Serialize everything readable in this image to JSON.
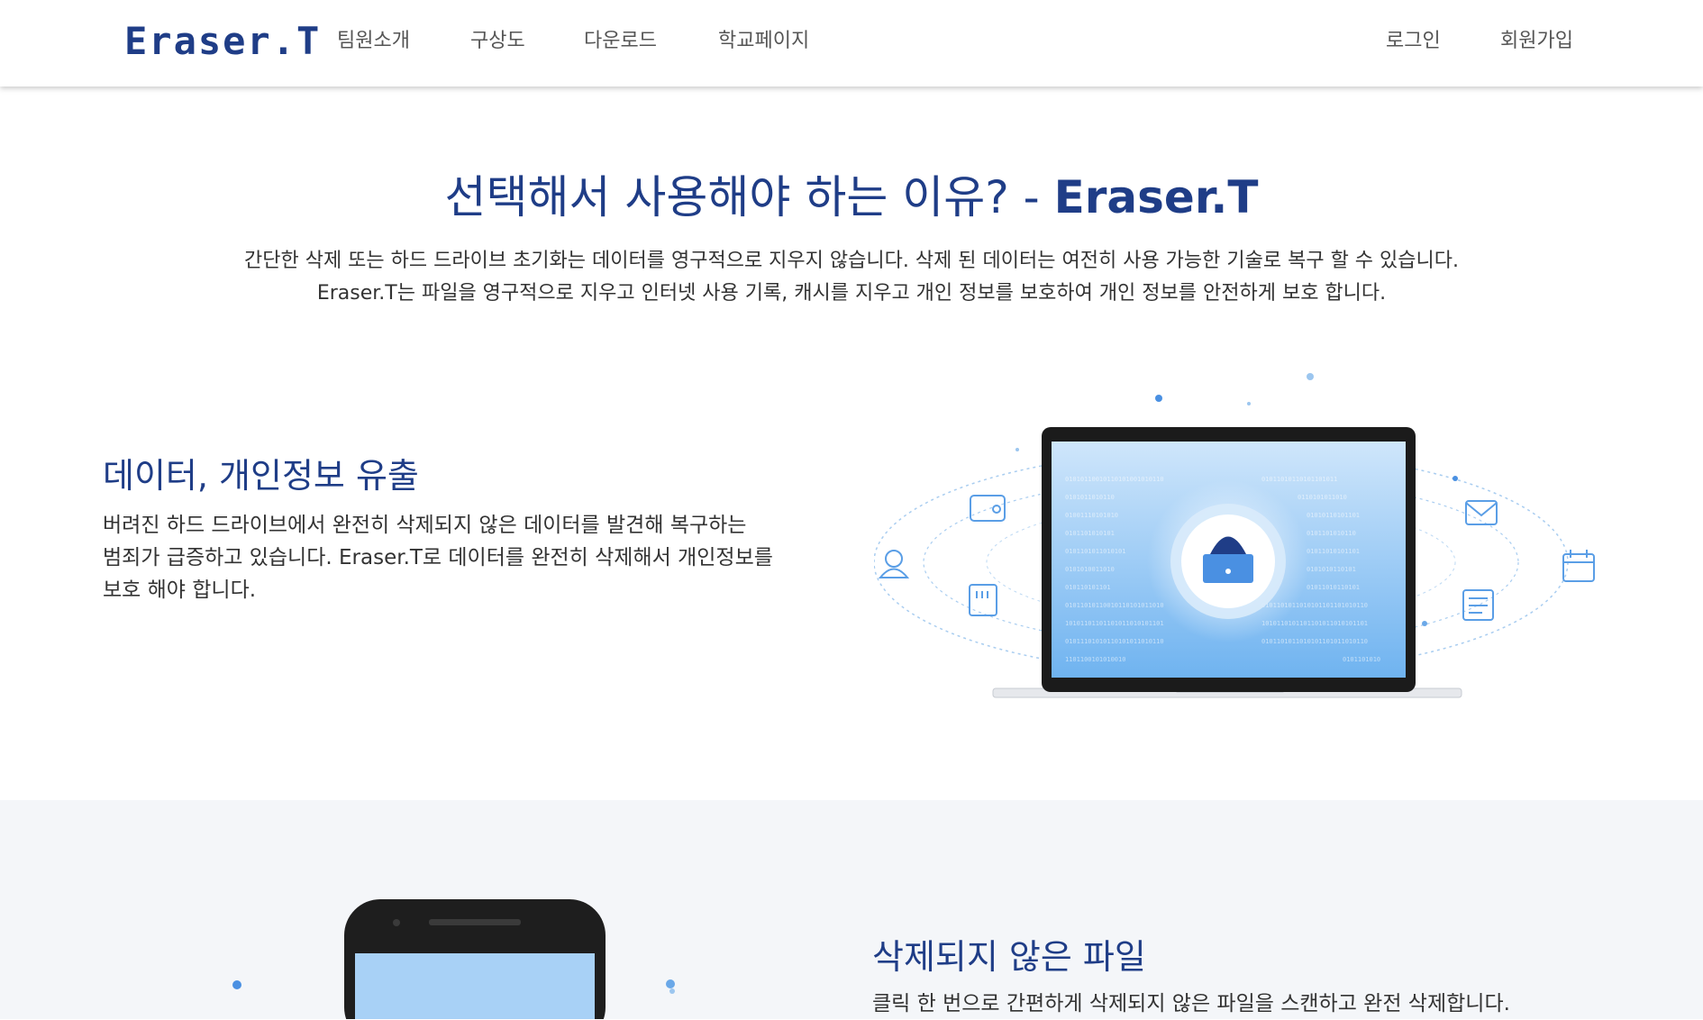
{
  "nav": {
    "logo": "Eraser.T",
    "links": [
      "팀원소개",
      "구상도",
      "다운로드",
      "학교페이지"
    ],
    "login": "로그인",
    "signup": "회원가입"
  },
  "hero": {
    "title_prefix": "선택해서 사용해야 하는 이유? - ",
    "title_brand": "Eraser.T",
    "desc_line1": "간단한 삭제 또는 하드 드라이브 초기화는 데이터를 영구적으로 지우지 않습니다. 삭제 된 데이터는 여전히 사용 가능한 기술로 복구 할 수 있습니다.",
    "desc_line2": "Eraser.T는 파일을 영구적으로 지우고 인터넷 사용 기록, 캐시를 지우고 개인 정보를 보호하여 개인 정보를 안전하게 보호 합니다."
  },
  "feature1": {
    "title": "데이터, 개인정보 유출",
    "line1": "버려진 하드 드라이브에서 완전히 삭제되지 않은 데이터를 발견해 복구하는",
    "line2": "범죄가 급증하고 있습니다. Eraser.T로 데이터를 완전히 삭제해서 개인정보를",
    "line3": "보호 해야 합니다."
  },
  "feature2": {
    "title": "삭제되지 않은 파일",
    "desc": "클릭 한 번으로 간편하게 삭제되지 않은 파일을 스캔하고 완전 삭제합니다."
  },
  "colors": {
    "brand": "#1f3d87",
    "accent": "#4a90e2",
    "section_bg": "#f4f6f9"
  }
}
